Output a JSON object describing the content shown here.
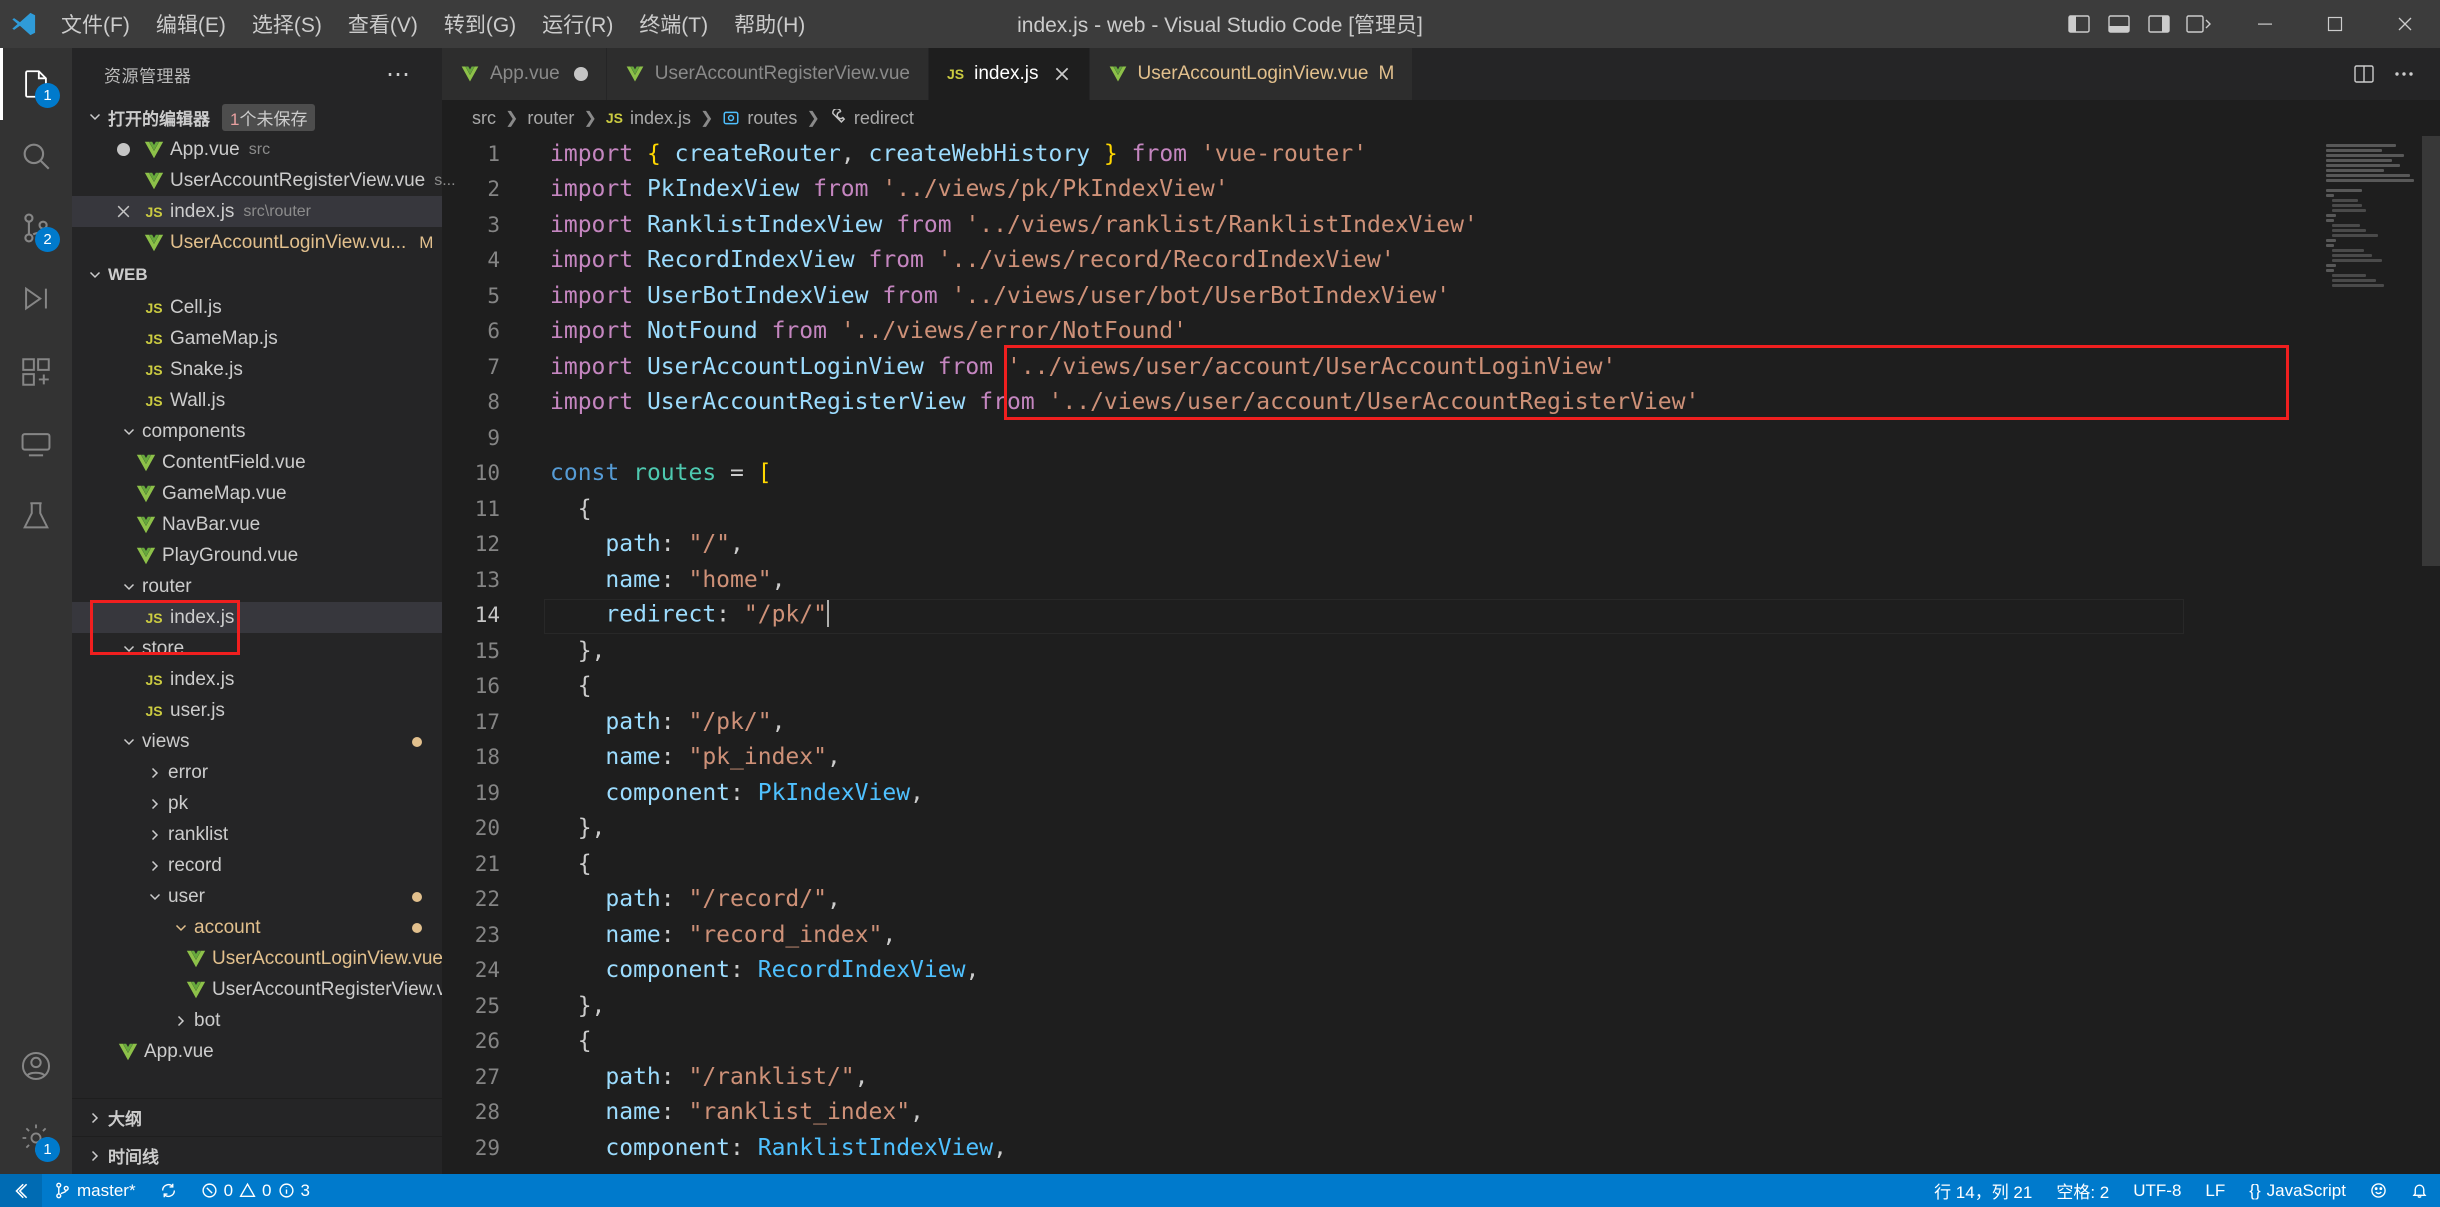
{
  "titlebar": {
    "logo_icon": "vscode-logo-icon",
    "menus": [
      "文件(F)",
      "编辑(E)",
      "选择(S)",
      "查看(V)",
      "转到(G)",
      "运行(R)",
      "终端(T)",
      "帮助(H)"
    ],
    "window_title": "index.js - web - Visual Studio Code [管理员]",
    "layout_icons": [
      "toggle-primary-sidebar-icon",
      "toggle-panel-icon",
      "toggle-secondary-sidebar-icon",
      "customize-layout-icon"
    ],
    "window_controls": {
      "minimize": "─",
      "maximize": "☐",
      "close": "✕"
    }
  },
  "activitybar": {
    "items": [
      {
        "name": "explorer",
        "icon": "files-icon",
        "badge": "1",
        "active": true
      },
      {
        "name": "search",
        "icon": "search-icon",
        "badge": "",
        "active": false
      },
      {
        "name": "source-control",
        "icon": "source-control-icon",
        "badge": "2",
        "active": false
      },
      {
        "name": "run-and-debug",
        "icon": "debug-icon",
        "badge": "",
        "active": false
      },
      {
        "name": "extensions",
        "icon": "extensions-icon",
        "badge": "",
        "active": false
      },
      {
        "name": "remote-explorer",
        "icon": "remote-explorer-icon",
        "badge": "",
        "active": false
      },
      {
        "name": "test",
        "icon": "beaker-icon",
        "badge": "",
        "active": false
      }
    ],
    "bottom_items": [
      {
        "name": "accounts",
        "icon": "account-icon",
        "badge": ""
      },
      {
        "name": "manage",
        "icon": "gear-icon",
        "badge": "1"
      }
    ]
  },
  "sidebar": {
    "title": "资源管理器",
    "more_actions": "⋯",
    "open_editors": {
      "label": "打开的编辑器",
      "unsaved_count": "1",
      "unsaved_suffix": "个未保存",
      "items": [
        {
          "indicator": "dirty-dot",
          "icon": "vue-icon",
          "name": "App.vue",
          "path": "src",
          "badge": "",
          "selected": false,
          "modified": false
        },
        {
          "indicator": "none",
          "icon": "vue-icon",
          "name": "UserAccountRegisterView.vue",
          "path": "s...",
          "badge": "",
          "selected": false,
          "modified": false
        },
        {
          "indicator": "close-x",
          "icon": "js-icon",
          "name": "index.js",
          "path": "src\\router",
          "badge": "",
          "selected": true,
          "modified": false
        },
        {
          "indicator": "none",
          "icon": "vue-icon",
          "name": "UserAccountLoginView.vu...",
          "path": "",
          "badge": "M",
          "selected": false,
          "modified": true
        }
      ]
    },
    "workspace": {
      "label": "WEB",
      "tree": [
        {
          "depth": 1,
          "kind": "file",
          "icon": "js-icon",
          "label": "Cell.js"
        },
        {
          "depth": 1,
          "kind": "file",
          "icon": "js-icon",
          "label": "GameMap.js"
        },
        {
          "depth": 1,
          "kind": "file",
          "icon": "js-icon",
          "label": "Snake.js"
        },
        {
          "depth": 1,
          "kind": "file",
          "icon": "js-icon",
          "label": "Wall.js"
        },
        {
          "depth": 0,
          "kind": "folder",
          "expanded": true,
          "label": "components"
        },
        {
          "depth": 1,
          "kind": "file",
          "icon": "vue-icon",
          "label": "ContentField.vue"
        },
        {
          "depth": 1,
          "kind": "file",
          "icon": "vue-icon",
          "label": "GameMap.vue"
        },
        {
          "depth": 1,
          "kind": "file",
          "icon": "vue-icon",
          "label": "NavBar.vue"
        },
        {
          "depth": 1,
          "kind": "file",
          "icon": "vue-icon",
          "label": "PlayGround.vue"
        },
        {
          "depth": 0,
          "kind": "folder",
          "expanded": true,
          "label": "router"
        },
        {
          "depth": 1,
          "kind": "file",
          "icon": "js-icon",
          "label": "index.js",
          "selected": true
        },
        {
          "depth": 0,
          "kind": "folder",
          "expanded": true,
          "label": "store"
        },
        {
          "depth": 1,
          "kind": "file",
          "icon": "js-icon",
          "label": "index.js"
        },
        {
          "depth": 1,
          "kind": "file",
          "icon": "js-icon",
          "label": "user.js"
        },
        {
          "depth": 0,
          "kind": "folder",
          "expanded": true,
          "label": "views",
          "dot": true
        },
        {
          "depth": 1,
          "kind": "folder",
          "expanded": false,
          "label": "error"
        },
        {
          "depth": 1,
          "kind": "folder",
          "expanded": false,
          "label": "pk"
        },
        {
          "depth": 1,
          "kind": "folder",
          "expanded": false,
          "label": "ranklist"
        },
        {
          "depth": 1,
          "kind": "folder",
          "expanded": false,
          "label": "record"
        },
        {
          "depth": 1,
          "kind": "folder",
          "expanded": true,
          "label": "user",
          "dot": true
        },
        {
          "depth": 2,
          "kind": "folder",
          "expanded": true,
          "label": "account",
          "modified": true,
          "dot": true
        },
        {
          "depth": 3,
          "kind": "file",
          "icon": "vue-icon",
          "label": "UserAccountLoginView.vue",
          "badge": "M",
          "modified": true
        },
        {
          "depth": 3,
          "kind": "file",
          "icon": "vue-icon",
          "label": "UserAccountRegisterView.vue"
        },
        {
          "depth": 2,
          "kind": "folder",
          "expanded": false,
          "label": "bot"
        },
        {
          "depth": 1,
          "kind": "file",
          "icon": "vue-icon",
          "label": "App.vue"
        }
      ]
    },
    "bottom_sections": [
      "大纲",
      "时间线"
    ]
  },
  "editor": {
    "tabs": [
      {
        "icon": "vue-icon",
        "label": "App.vue",
        "indicator": "dot",
        "active": false,
        "modified": false
      },
      {
        "icon": "vue-icon",
        "label": "UserAccountRegisterView.vue",
        "indicator": "none",
        "active": false,
        "modified": false
      },
      {
        "icon": "js-icon",
        "label": "index.js",
        "indicator": "close",
        "active": true,
        "modified": false
      },
      {
        "icon": "vue-icon",
        "label": "UserAccountLoginView.vue",
        "indicator": "M",
        "active": false,
        "modified": true
      }
    ],
    "tab_actions": [
      "split-editor-icon",
      "more-actions-icon"
    ],
    "breadcrumbs": [
      {
        "icon": "",
        "label": "src"
      },
      {
        "icon": "js-icon",
        "label": "index.js"
      },
      {
        "icon": "array-symbol-icon",
        "label": "routes"
      },
      {
        "icon": "property-symbol-icon",
        "label": "redirect"
      }
    ],
    "lines": [
      {
        "n": 1,
        "tokens": [
          [
            "t-kw",
            "import "
          ],
          [
            "t-brc",
            "{ "
          ],
          [
            "t-var",
            "createRouter"
          ],
          [
            "t-pun",
            ", "
          ],
          [
            "t-var",
            "createWebHistory"
          ],
          [
            "t-brc",
            " }"
          ],
          [
            "t-kw",
            " from "
          ],
          [
            "t-str",
            "'vue-router'"
          ]
        ]
      },
      {
        "n": 2,
        "tokens": [
          [
            "t-kw",
            "import "
          ],
          [
            "t-var",
            "PkIndexView"
          ],
          [
            "t-kw",
            " from "
          ],
          [
            "t-str",
            "'../views/pk/PkIndexView'"
          ]
        ]
      },
      {
        "n": 3,
        "tokens": [
          [
            "t-kw",
            "import "
          ],
          [
            "t-var",
            "RanklistIndexView"
          ],
          [
            "t-kw",
            " from "
          ],
          [
            "t-str",
            "'../views/ranklist/RanklistIndexView'"
          ]
        ]
      },
      {
        "n": 4,
        "tokens": [
          [
            "t-kw",
            "import "
          ],
          [
            "t-var",
            "RecordIndexView"
          ],
          [
            "t-kw",
            " from "
          ],
          [
            "t-str",
            "'../views/record/RecordIndexView'"
          ]
        ]
      },
      {
        "n": 5,
        "tokens": [
          [
            "t-kw",
            "import "
          ],
          [
            "t-var",
            "UserBotIndexView"
          ],
          [
            "t-kw",
            " from "
          ],
          [
            "t-str",
            "'../views/user/bot/UserBotIndexView'"
          ]
        ]
      },
      {
        "n": 6,
        "tokens": [
          [
            "t-kw",
            "import "
          ],
          [
            "t-var",
            "NotFound"
          ],
          [
            "t-kw",
            " from "
          ],
          [
            "t-str",
            "'../views/error/NotFound'"
          ]
        ]
      },
      {
        "n": 7,
        "tokens": [
          [
            "t-kw",
            "import "
          ],
          [
            "t-var",
            "UserAccountLoginView"
          ],
          [
            "t-kw",
            " from "
          ],
          [
            "t-str",
            "'../views/user/account/UserAccountLoginView'"
          ]
        ]
      },
      {
        "n": 8,
        "tokens": [
          [
            "t-kw",
            "import "
          ],
          [
            "t-var",
            "UserAccountRegisterView"
          ],
          [
            "t-kw",
            " from "
          ],
          [
            "t-str",
            "'../views/user/account/UserAccountRegisterView'"
          ]
        ]
      },
      {
        "n": 9,
        "tokens": []
      },
      {
        "n": 10,
        "tokens": [
          [
            "t-key",
            "const "
          ],
          [
            "t-cls",
            "routes"
          ],
          [
            "t-pun",
            " = "
          ],
          [
            "t-brc",
            "["
          ]
        ]
      },
      {
        "n": 11,
        "tokens": [
          [
            "t-pun",
            "  {"
          ]
        ]
      },
      {
        "n": 12,
        "tokens": [
          [
            "t-prop",
            "    path"
          ],
          [
            "t-pun",
            ": "
          ],
          [
            "t-str",
            "\"/\""
          ],
          [
            "t-pun",
            ","
          ]
        ]
      },
      {
        "n": 13,
        "tokens": [
          [
            "t-prop",
            "    name"
          ],
          [
            "t-pun",
            ": "
          ],
          [
            "t-str",
            "\"home\""
          ],
          [
            "t-pun",
            ","
          ]
        ]
      },
      {
        "n": 14,
        "tokens": [
          [
            "t-prop",
            "    redirect"
          ],
          [
            "t-pun",
            ": "
          ],
          [
            "t-str",
            "\"/pk/\""
          ]
        ],
        "caret": true,
        "current": true
      },
      {
        "n": 15,
        "tokens": [
          [
            "t-pun",
            "  },"
          ]
        ]
      },
      {
        "n": 16,
        "tokens": [
          [
            "t-pun",
            "  {"
          ]
        ]
      },
      {
        "n": 17,
        "tokens": [
          [
            "t-prop",
            "    path"
          ],
          [
            "t-pun",
            ": "
          ],
          [
            "t-str",
            "\"/pk/\""
          ],
          [
            "t-pun",
            ","
          ]
        ]
      },
      {
        "n": 18,
        "tokens": [
          [
            "t-prop",
            "    name"
          ],
          [
            "t-pun",
            ": "
          ],
          [
            "t-str",
            "\"pk_index\""
          ],
          [
            "t-pun",
            ","
          ]
        ]
      },
      {
        "n": 19,
        "tokens": [
          [
            "t-prop",
            "    component"
          ],
          [
            "t-pun",
            ": "
          ],
          [
            "t-con",
            "PkIndexView"
          ],
          [
            "t-pun",
            ","
          ]
        ]
      },
      {
        "n": 20,
        "tokens": [
          [
            "t-pun",
            "  },"
          ]
        ]
      },
      {
        "n": 21,
        "tokens": [
          [
            "t-pun",
            "  {"
          ]
        ]
      },
      {
        "n": 22,
        "tokens": [
          [
            "t-prop",
            "    path"
          ],
          [
            "t-pun",
            ": "
          ],
          [
            "t-str",
            "\"/record/\""
          ],
          [
            "t-pun",
            ","
          ]
        ]
      },
      {
        "n": 23,
        "tokens": [
          [
            "t-prop",
            "    name"
          ],
          [
            "t-pun",
            ": "
          ],
          [
            "t-str",
            "\"record_index\""
          ],
          [
            "t-pun",
            ","
          ]
        ]
      },
      {
        "n": 24,
        "tokens": [
          [
            "t-prop",
            "    component"
          ],
          [
            "t-pun",
            ": "
          ],
          [
            "t-con",
            "RecordIndexView"
          ],
          [
            "t-pun",
            ","
          ]
        ]
      },
      {
        "n": 25,
        "tokens": [
          [
            "t-pun",
            "  },"
          ]
        ]
      },
      {
        "n": 26,
        "tokens": [
          [
            "t-pun",
            "  {"
          ]
        ]
      },
      {
        "n": 27,
        "tokens": [
          [
            "t-prop",
            "    path"
          ],
          [
            "t-pun",
            ": "
          ],
          [
            "t-str",
            "\"/ranklist/\""
          ],
          [
            "t-pun",
            ","
          ]
        ]
      },
      {
        "n": 28,
        "tokens": [
          [
            "t-prop",
            "    name"
          ],
          [
            "t-pun",
            ": "
          ],
          [
            "t-str",
            "\"ranklist_index\""
          ],
          [
            "t-pun",
            ","
          ]
        ]
      },
      {
        "n": 29,
        "tokens": [
          [
            "t-prop",
            "    component"
          ],
          [
            "t-pun",
            ": "
          ],
          [
            "t-con",
            "RanklistIndexView"
          ],
          [
            "t-pun",
            ","
          ]
        ]
      }
    ]
  },
  "statusbar": {
    "remote_icon": "remote-window-icon",
    "branch": "master*",
    "sync_icon": "sync-icon",
    "errors": "0",
    "warnings": "0",
    "infos": "3",
    "cursor_position": "行 14，列 21",
    "indentation": "空格: 2",
    "encoding": "UTF-8",
    "eol": "LF",
    "language": "JavaScript",
    "feedback_icon": "smiley-icon",
    "bell_icon": "bell-icon"
  },
  "colors": {
    "accent": "#007acc",
    "titlebar_bg": "#3c3c3c",
    "sidebar_bg": "#252526",
    "editor_bg": "#1e1e1e",
    "highlight_box": "#f01f1f",
    "modified": "#e2c08d"
  }
}
